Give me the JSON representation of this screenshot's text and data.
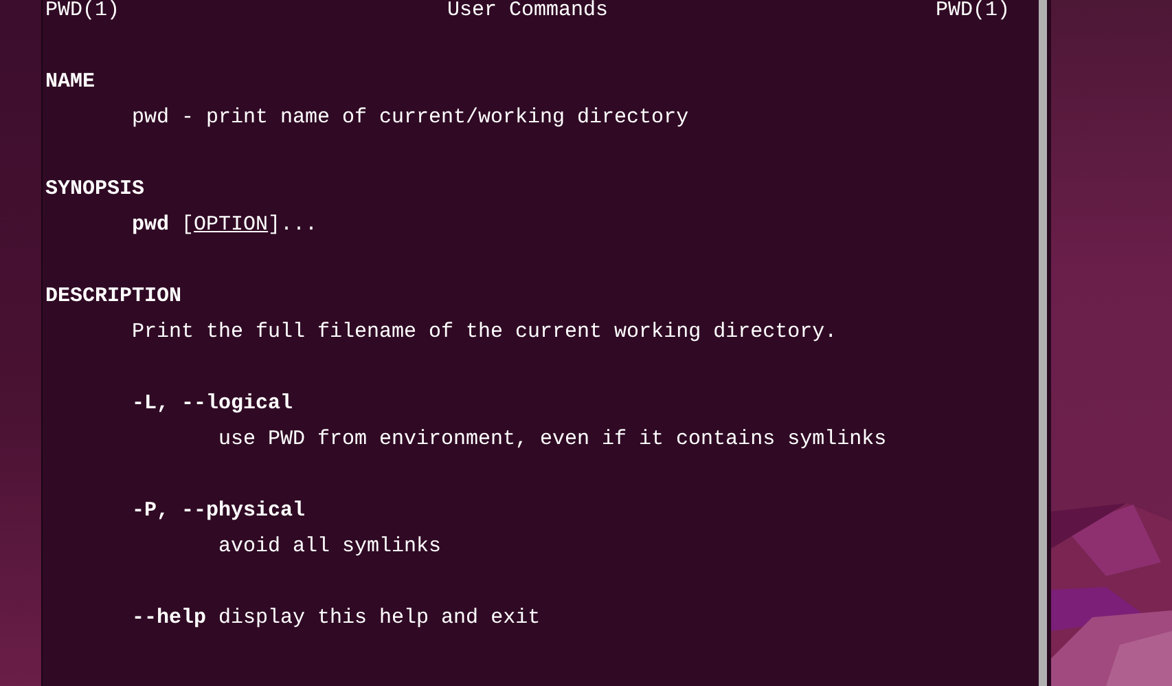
{
  "header": {
    "left": "PWD(1)",
    "center": "User Commands",
    "right": "PWD(1)"
  },
  "sections": [
    {
      "heading": "NAME",
      "body": [
        {
          "kind": "para",
          "parts": [
            {
              "text": "pwd - print name of current/working directory",
              "bold": false,
              "underline": false
            }
          ]
        }
      ]
    },
    {
      "heading": "SYNOPSIS",
      "body": [
        {
          "kind": "para",
          "parts": [
            {
              "text": "pwd",
              "bold": true,
              "underline": false
            },
            {
              "text": " [",
              "bold": false,
              "underline": false
            },
            {
              "text": "OPTION",
              "bold": false,
              "underline": true
            },
            {
              "text": "]...",
              "bold": false,
              "underline": false
            }
          ]
        }
      ]
    },
    {
      "heading": "DESCRIPTION",
      "body": [
        {
          "kind": "para",
          "parts": [
            {
              "text": "Print the full filename of the current working directory.",
              "bold": false,
              "underline": false
            }
          ]
        },
        {
          "kind": "option",
          "term": "-L, --logical",
          "detail": "use PWD from environment, even if it contains symlinks"
        },
        {
          "kind": "option",
          "term": "-P, --physical",
          "detail": "avoid all symlinks"
        },
        {
          "kind": "inline-option",
          "term": "--help",
          "detail": "display this help and exit"
        }
      ]
    }
  ]
}
